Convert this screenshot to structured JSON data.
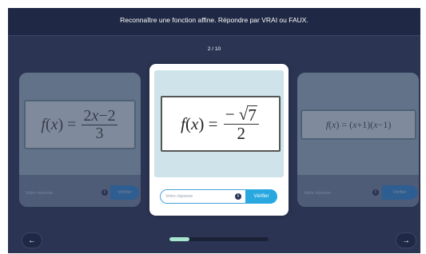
{
  "header": {
    "title": "Reconnaître une fonction affine. Répondre par VRAI ou FAUX."
  },
  "quiz": {
    "counter": "2 / 10",
    "progress_fraction": 0.2
  },
  "cards": {
    "left": {
      "formula_text": "f(x) = (2x − 2) / 3",
      "input_placeholder": "Votre réponse",
      "button_label": "Vérifier"
    },
    "center": {
      "formula_text": "f(x) = −√7 / 2",
      "input_placeholder": "Votre réponse",
      "input_value": "",
      "button_label": "Vérifier"
    },
    "right": {
      "formula_text": "f(x) = (x+1)(x−1)",
      "input_placeholder": "Votre réponse",
      "button_label": "Vérifier"
    }
  },
  "navigation": {
    "prev_icon": "arrow-left-icon",
    "next_icon": "arrow-right-icon"
  },
  "colors": {
    "background": "#2b3553",
    "topbar": "#1f2844",
    "accent": "#29a8e0",
    "progress": "#a7e6cf"
  }
}
